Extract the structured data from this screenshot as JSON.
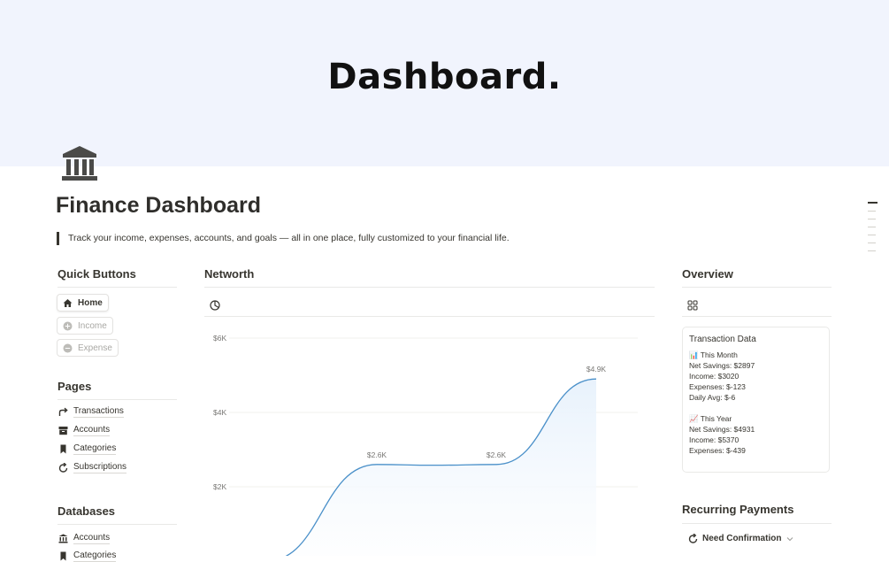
{
  "cover": {
    "title": "Dashboard."
  },
  "page": {
    "title": "Finance Dashboard",
    "description": "Track your income, expenses, accounts, and goals — all in one place, fully customized to your financial life.",
    "icon": "bank-building-icon"
  },
  "quick_buttons": {
    "heading": "Quick Buttons",
    "items": [
      {
        "label": "Home",
        "icon": "home-icon",
        "state": "active"
      },
      {
        "label": "Income",
        "icon": "plus-circle-icon",
        "state": "disabled"
      },
      {
        "label": "Expense",
        "icon": "minus-circle-icon",
        "state": "disabled"
      }
    ]
  },
  "pages": {
    "heading": "Pages",
    "items": [
      {
        "label": "Transactions",
        "icon": "redirect-arrow-icon"
      },
      {
        "label": "Accounts",
        "icon": "archive-box-icon"
      },
      {
        "label": "Categories",
        "icon": "bookmark-icon"
      },
      {
        "label": "Subscriptions",
        "icon": "refresh-icon"
      }
    ]
  },
  "databases": {
    "heading": "Databases",
    "items": [
      {
        "label": "Accounts",
        "icon": "bank-icon"
      },
      {
        "label": "Categories",
        "icon": "bookmark-icon"
      }
    ]
  },
  "networth": {
    "heading": "Networth",
    "toolbar_icon": "pie-chart-icon"
  },
  "chart_data": {
    "type": "area",
    "title": "",
    "xlabel": "",
    "ylabel": "",
    "y_tick_labels": [
      "$2K",
      "$4K",
      "$6K"
    ],
    "y_ticks": [
      2000,
      4000,
      6000
    ],
    "ylim": [
      0,
      6500
    ],
    "x": [
      0,
      1,
      2,
      3,
      4
    ],
    "values": [
      0,
      2600,
      2580,
      2600,
      4900
    ],
    "data_labels": [
      {
        "index": 1,
        "text": "$2.6K"
      },
      {
        "index": 3,
        "text": "$2.6K"
      },
      {
        "index": 4,
        "text": "$4.9K"
      }
    ],
    "line_color": "#4a90c9",
    "fill_color": "#e8f2fc",
    "grid": true
  },
  "overview": {
    "heading": "Overview",
    "toolbar_icon": "gallery-grid-icon",
    "card": {
      "title": "Transaction Data",
      "month_label": "📊 This Month",
      "month_lines": [
        "Net Savings: $2897",
        "Income: $3020",
        "Expenses: $-123",
        "Daily Avg: $-6"
      ],
      "year_label": "📈 This Year",
      "year_lines": [
        "Net Savings: $4931",
        "Income: $5370",
        "Expenses: $-439"
      ]
    }
  },
  "recurring": {
    "heading": "Recurring Payments",
    "filter_label": "Need Confirmation",
    "filter_icon": "refresh-icon"
  }
}
